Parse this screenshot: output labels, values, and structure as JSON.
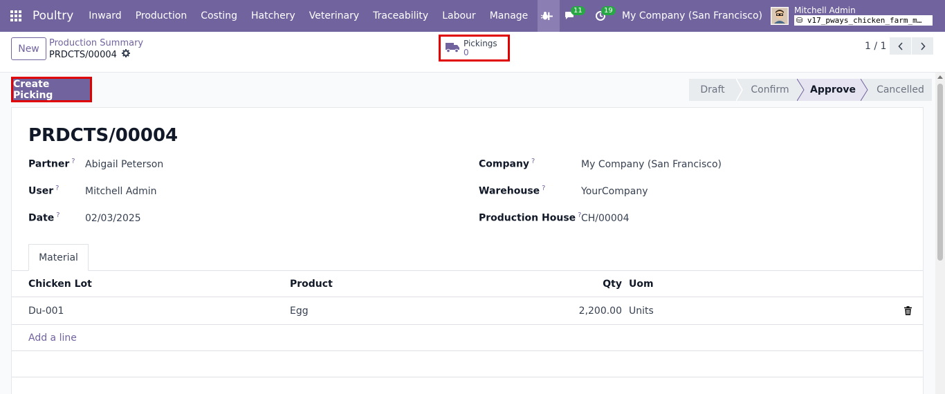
{
  "navbar": {
    "brand": "Poultry",
    "menu": [
      "Inward",
      "Production",
      "Costing",
      "Hatchery",
      "Veterinary",
      "Traceability",
      "Labour",
      "Manage"
    ],
    "messages_count": "11",
    "activities_count": "19",
    "company": "My Company (San Francisco)",
    "user_name": "Mitchell Admin",
    "db_name": "v17_pways_chicken_farm_m…"
  },
  "control": {
    "new_label": "New",
    "breadcrumb_parent": "Production Summary",
    "breadcrumb_current": "PRDCTS/00004",
    "smart_label": "Pickings",
    "smart_count": "0",
    "pager": "1 / 1"
  },
  "actions": {
    "create_picking": "Create Picking"
  },
  "status": {
    "stages": [
      "Draft",
      "Confirm",
      "Approve",
      "Cancelled"
    ],
    "active": "Approve"
  },
  "form": {
    "title": "PRDCTS/00004",
    "partner_label": "Partner",
    "partner": "Abigail Peterson",
    "user_label": "User",
    "user": "Mitchell Admin",
    "date_label": "Date",
    "date": "02/03/2025",
    "company_label": "Company",
    "company": "My Company (San Francisco)",
    "warehouse_label": "Warehouse",
    "warehouse": "YourCompany",
    "house_label": "Production House",
    "house": "CH/00004",
    "help_mark": "?"
  },
  "tabs": {
    "material": "Material"
  },
  "table": {
    "headers": {
      "lot": "Chicken Lot",
      "product": "Product",
      "qty": "Qty",
      "uom": "Uom"
    },
    "rows": [
      {
        "lot": "Du-001",
        "product": "Egg",
        "qty": "2,200.00",
        "uom": "Units"
      }
    ],
    "add_line": "Add a line"
  },
  "colors": {
    "brand": "#71639e",
    "highlight": "#e00000",
    "badge": "#28a745"
  }
}
